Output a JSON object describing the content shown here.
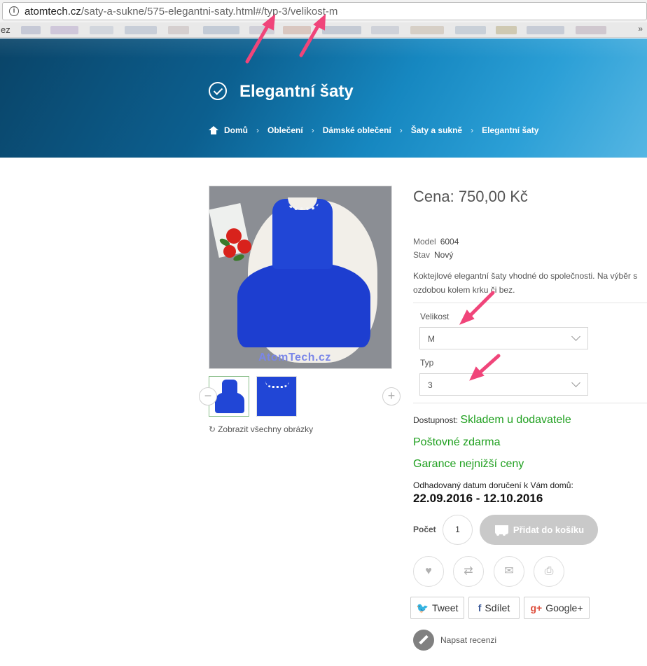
{
  "browser": {
    "url_host": "atomtech.cz",
    "url_path": "/saty-a-sukne/575-elegantni-saty.html#/typ-3/velikost-m",
    "bookmark_cut_label": "ez",
    "overflow_icon": "double-chevron-right-icon"
  },
  "header": {
    "title": "Elegantní šaty",
    "title_icon": "check-circle-icon",
    "breadcrumb": [
      "Domů",
      "Oblečení",
      "Dámské oblečení",
      "Šaty a sukně",
      "Elegantní šaty"
    ],
    "gradient_colors": [
      "#0a4468",
      "#1687c0",
      "#55b6e3"
    ]
  },
  "gallery": {
    "watermark": "AtomTech.cz",
    "show_all": "Zobrazit všechny obrázky",
    "thumbnail_count": 2
  },
  "product": {
    "price": "Cena: 750,00 Kč",
    "model_label": "Model",
    "model_value": "6004",
    "condition_label": "Stav",
    "condition_value": "Nový",
    "description": "Koktejlové elegantní šaty vhodné do společnosti. Na výběr s ozdobou kolem krku či bez."
  },
  "options": {
    "size_label": "Velikost",
    "size_value": "M",
    "type_label": "Typ",
    "type_value": "3"
  },
  "availability": {
    "label": "Dostupnost:",
    "value": "Skladem u dodavatele",
    "shipping": "Poštovné zdarma",
    "guarantee": "Garance nejnižší ceny",
    "delivery_label": "Odhadovaný datum doručení k Vám domů:",
    "delivery_date": "22.09.2016 - 12.10.2016",
    "green_color": "#20a020"
  },
  "cart": {
    "qty_label": "Počet",
    "qty_value": "1",
    "add_label": "Přidat do košíku",
    "button_color": "#c9c9c9"
  },
  "actions": [
    "heart-icon",
    "compare-icon",
    "envelope-icon",
    "print-icon"
  ],
  "share": {
    "twitter": "Tweet",
    "facebook": "Sdílet",
    "google": "Google+",
    "twitter_glyph": "🐦",
    "facebook_glyph": "f",
    "google_glyph": "g+"
  },
  "review": {
    "label": "Napsat recenzi"
  },
  "annotation_color": "#f0457a"
}
